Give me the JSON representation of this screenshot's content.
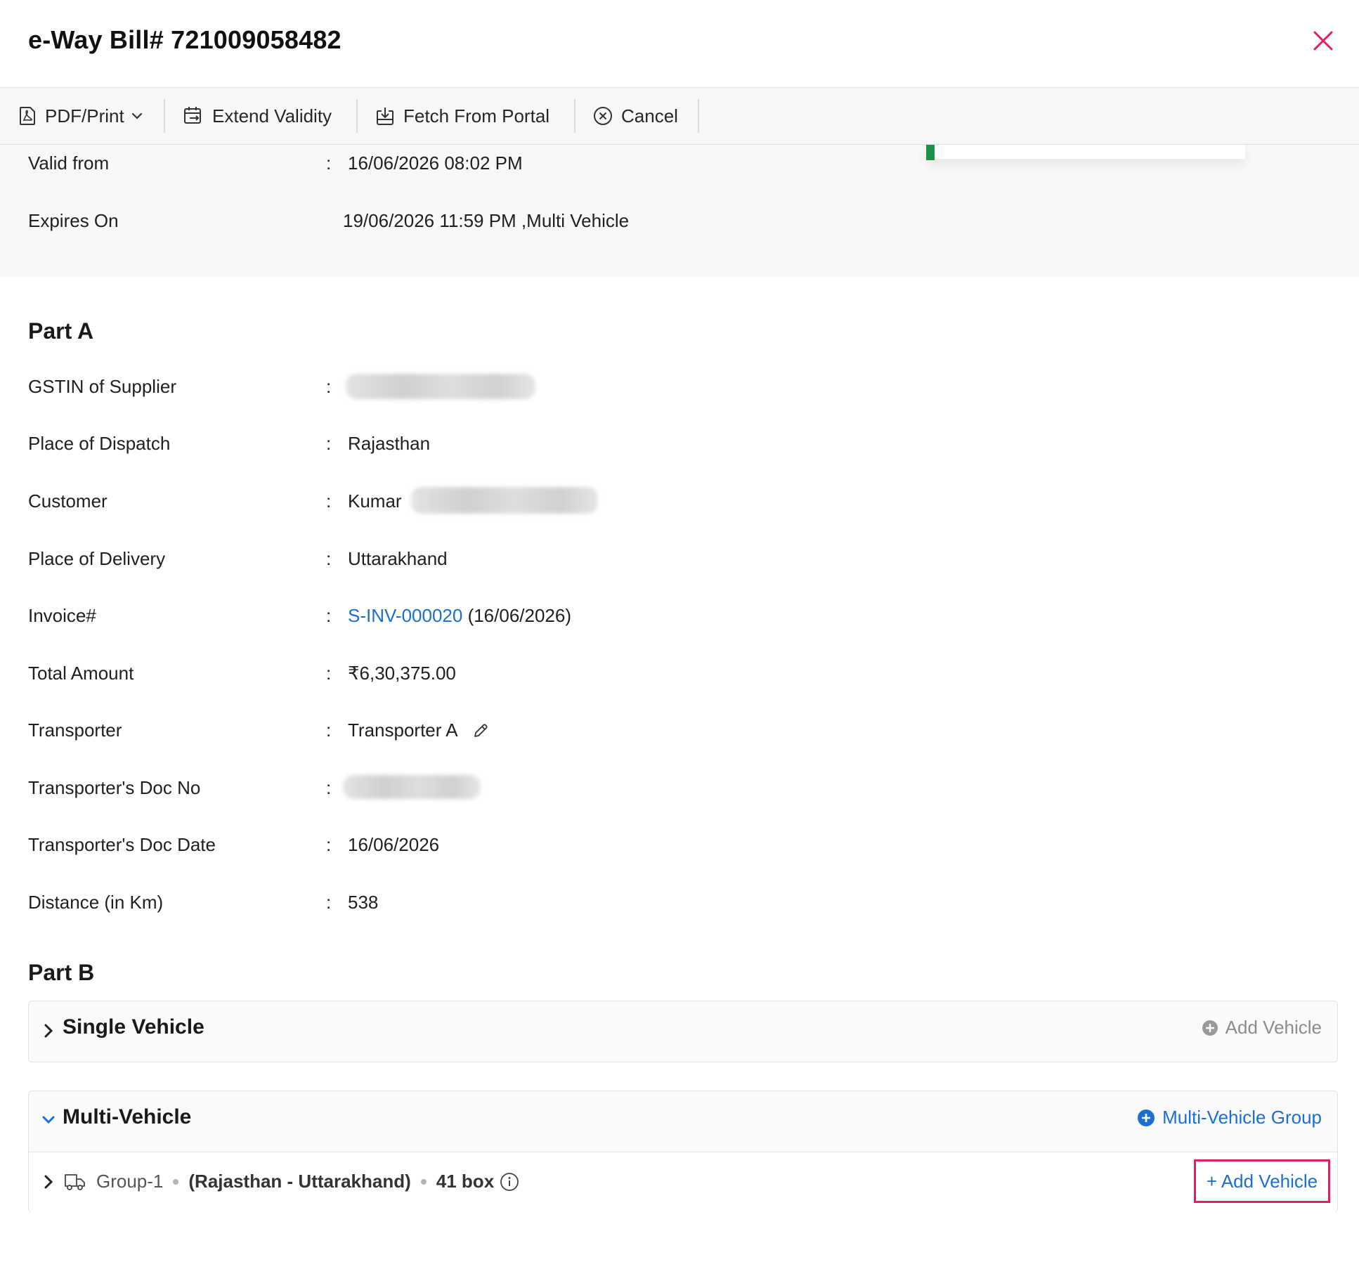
{
  "header": {
    "title": "e-Way Bill# 721009058482"
  },
  "toolbar": {
    "pdf_print": "PDF/Print",
    "extend_validity": "Extend Validity",
    "fetch_from_portal": "Fetch From Portal",
    "cancel": "Cancel"
  },
  "validity": {
    "valid_from_label": "Valid from",
    "valid_from_value": "16/06/2026 08:02 PM",
    "expires_on_label": "Expires On",
    "expires_on_value": "19/06/2026 11:59 PM ,Multi Vehicle"
  },
  "colon": ":",
  "part_a": {
    "title": "Part A",
    "gstin_label": "GSTIN of Supplier",
    "dispatch_label": "Place of Dispatch",
    "dispatch_value": "Rajasthan",
    "customer_label": "Customer",
    "customer_value": "Kumar",
    "delivery_label": "Place of Delivery",
    "delivery_value": "Uttarakhand",
    "invoice_label": "Invoice#",
    "invoice_link": "S-INV-000020",
    "invoice_date": "(16/06/2026)",
    "total_label": "Total Amount",
    "total_value": "₹6,30,375.00",
    "transporter_label": "Transporter",
    "transporter_value": "Transporter A",
    "doc_no_label": "Transporter's Doc No",
    "doc_date_label": "Transporter's Doc Date",
    "doc_date_value": "16/06/2026",
    "distance_label": "Distance (in Km)",
    "distance_value": "538"
  },
  "part_b": {
    "title": "Part B",
    "single_vehicle": {
      "title": "Single Vehicle",
      "action": "Add Vehicle"
    },
    "multi_vehicle": {
      "title": "Multi-Vehicle",
      "action": "Multi-Vehicle Group",
      "group": {
        "name": "Group-1",
        "route": "(Rajasthan - Uttarakhand)",
        "quantity": "41 box",
        "add_vehicle": "+ Add Vehicle"
      }
    }
  },
  "colors": {
    "accent": "#1c6fd1",
    "close": "#e01f5f",
    "highlight": "#e01f5f",
    "status_green": "#1a9447"
  }
}
